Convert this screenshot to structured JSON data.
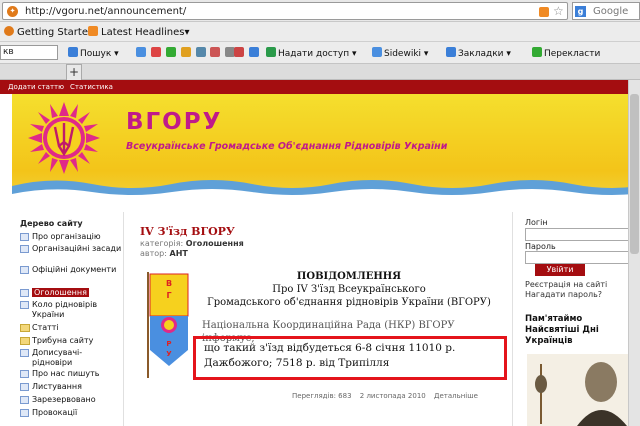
{
  "browser": {
    "url": "http://vgoru.net/announcement/",
    "search_engine": "Google",
    "bookmarks": [
      {
        "label": "Getting Started"
      },
      {
        "label": "Latest Headlines▾"
      }
    ],
    "toolbar": {
      "search_value": "кв",
      "items": [
        "Пошук ▾",
        "Надати доступ ▾",
        "Sidewiki ▾",
        "Закладки ▾",
        "Перекласти"
      ]
    },
    "new_tab": "+"
  },
  "site": {
    "top_links": [
      "Додати статтю",
      "Статистика"
    ],
    "name": "ВГОРУ",
    "subtitle": "Всеукраїнське Громадське Об'єднання Рідновірів України",
    "brand_color": "#a40d10",
    "accent_color": "#c01a8a"
  },
  "sidebar": {
    "title": "Дерево сайту",
    "items": [
      {
        "label": "Про організацію",
        "type": "page"
      },
      {
        "label": "Організаційні засади",
        "type": "page"
      },
      {
        "label": "Офіційні документи",
        "type": "page"
      },
      {
        "label": "Оголошення",
        "type": "page",
        "active": true
      },
      {
        "label": "Коло рідновірів України",
        "type": "page"
      },
      {
        "label": "Статті",
        "type": "folder"
      },
      {
        "label": "Трибуна сайту",
        "type": "folder"
      },
      {
        "label": "Дописувачі-рідновіри",
        "type": "page"
      },
      {
        "label": "Про нас пишуть",
        "type": "page"
      },
      {
        "label": "Листування",
        "type": "page"
      },
      {
        "label": "Зарезервовано",
        "type": "page"
      },
      {
        "label": "Провокації",
        "type": "page"
      }
    ]
  },
  "article": {
    "title": "IV З'їзд ВГОРУ",
    "category_label": "категорія:",
    "category": "Оголошення",
    "author_label": "автор:",
    "author": "АНТ",
    "notice_heading": "ПОВІДОМЛЕННЯ",
    "notice_line2": "Про IV З'їзд Всеукраїнського",
    "notice_line3": "Громадського об'єднання рідновірів України (ВГОРУ)",
    "body_faded": "Національна Координаційна Рада (НКР) ВГОРУ інформує,",
    "highlight": "що такий з'їзд відбудеться 6-8 січня 11010 р. Дажбожого; 7518 р. від Трипілля",
    "views": "Переглядів: 683",
    "date": "2 листопада 2010",
    "details": "Детальніше"
  },
  "right": {
    "login_label": "Логін",
    "password_label": "Пароль",
    "login_button": "Увійти",
    "register_link": "Реєстрація на сайті",
    "forgot_link": "Нагадати пароль?",
    "remember_heading": "Пам'ятаймо Найсвятіші Дні Українців"
  }
}
